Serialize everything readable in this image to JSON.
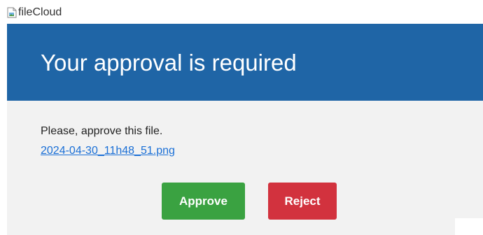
{
  "logo": {
    "alt_text": "fileCloud",
    "icon": "broken-image-icon"
  },
  "header": {
    "title": "Your approval is required",
    "background_color": "#1f65a6"
  },
  "body": {
    "message": "Please, approve this file.",
    "file_link": "2024-04-30_11h48_51.png",
    "background_color": "#f2f2f2"
  },
  "actions": {
    "approve_label": "Approve",
    "approve_color": "#3aa241",
    "reject_label": "Reject",
    "reject_color": "#d2323e"
  }
}
